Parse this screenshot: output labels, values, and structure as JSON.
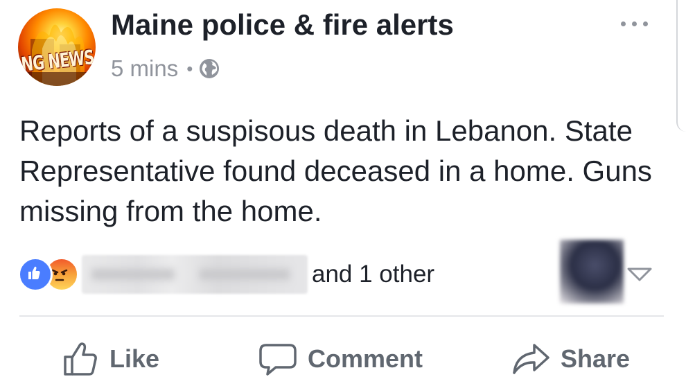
{
  "post": {
    "page_name": "Maine police & fire alerts",
    "timestamp": "5 mins",
    "separator": "•",
    "privacy_icon": "globe-icon",
    "avatar_logo_text": "NG NEWS",
    "body": "Reports of a suspisous death in Lebanon. State Representative found deceased in a home. Guns missing from the home."
  },
  "reactions": {
    "icons": [
      "like-reaction-icon",
      "angry-reaction-icon"
    ],
    "others_text": "and 1 other"
  },
  "actions": {
    "like_label": "Like",
    "comment_label": "Comment",
    "share_label": "Share"
  },
  "colors": {
    "text": "#1d2129",
    "meta": "#90949c",
    "action": "#606770",
    "like_blue": "#4a7dff"
  }
}
